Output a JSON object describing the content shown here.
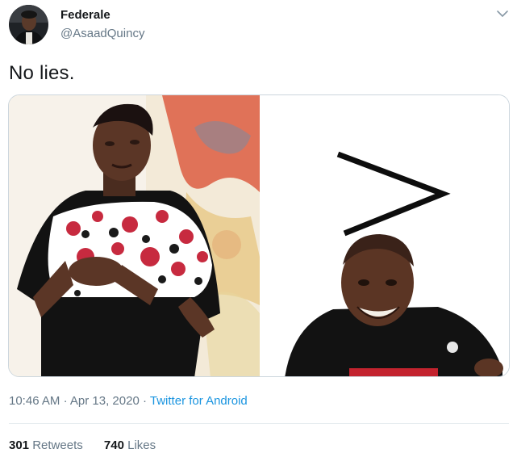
{
  "author": {
    "name": "Federale",
    "handle": "@AsaadQuincy"
  },
  "tweet": {
    "text": "No lies."
  },
  "meta": {
    "time": "10:46 AM",
    "separator_1": "·",
    "date": "Apr 13, 2020",
    "separator_2": "·",
    "source": "Twitter for Android"
  },
  "stats": {
    "retweets_count": "301",
    "retweets_label": "Retweets",
    "likes_count": "740",
    "likes_label": "Likes"
  },
  "icons": {
    "caret": "chevron-down-icon",
    "comparison": "greater-than-symbol"
  },
  "colors": {
    "text_primary": "#14171a",
    "text_secondary": "#657786",
    "link": "#1b95e0",
    "border": "#ccd6dd"
  }
}
